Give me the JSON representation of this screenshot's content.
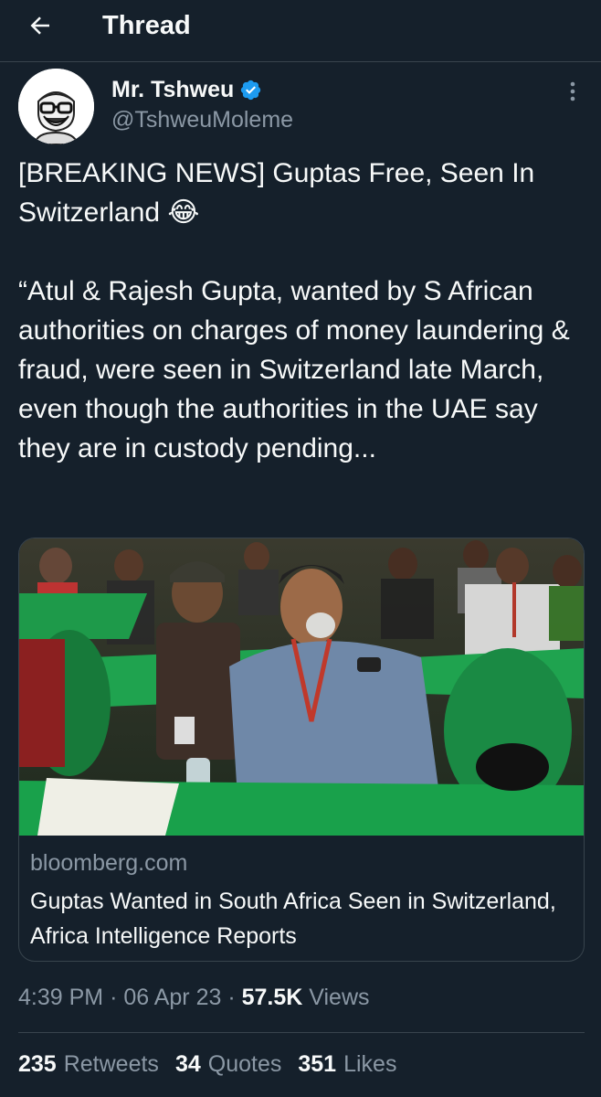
{
  "header": {
    "title": "Thread",
    "back_icon": "arrow-left-icon"
  },
  "tweet": {
    "author_name": "Mr. Tshweu",
    "handle": "@TshweuMoleme",
    "verified": true,
    "verified_color": "#1d9bf0",
    "text_line1": "[BREAKING NEWS] Guptas Free, Seen In Switzerland 😂",
    "text_line2": "“Atul & Rajesh Gupta, wanted by S African authorities on charges of money laundering & fraud, were seen in Switzerland late March, even though the authorities in the UAE say they are in custody pending...",
    "card": {
      "domain": "bloomberg.com",
      "title": "Guptas Wanted in South Africa Seen in Switzerland, Africa Intelligence Reports"
    },
    "time": "4:39 PM",
    "date": "06 Apr 23",
    "views_count": "57.5K",
    "views_label": "Views",
    "separator": "·"
  },
  "stats": {
    "retweets_count": "235",
    "retweets_label": "Retweets",
    "quotes_count": "34",
    "quotes_label": "Quotes",
    "likes_count": "351",
    "likes_label": "Likes"
  },
  "colors": {
    "background": "#15202b",
    "text_primary": "#f7f9f9",
    "text_secondary": "#8b98a5",
    "border": "#38444d",
    "accent": "#1d9bf0"
  }
}
